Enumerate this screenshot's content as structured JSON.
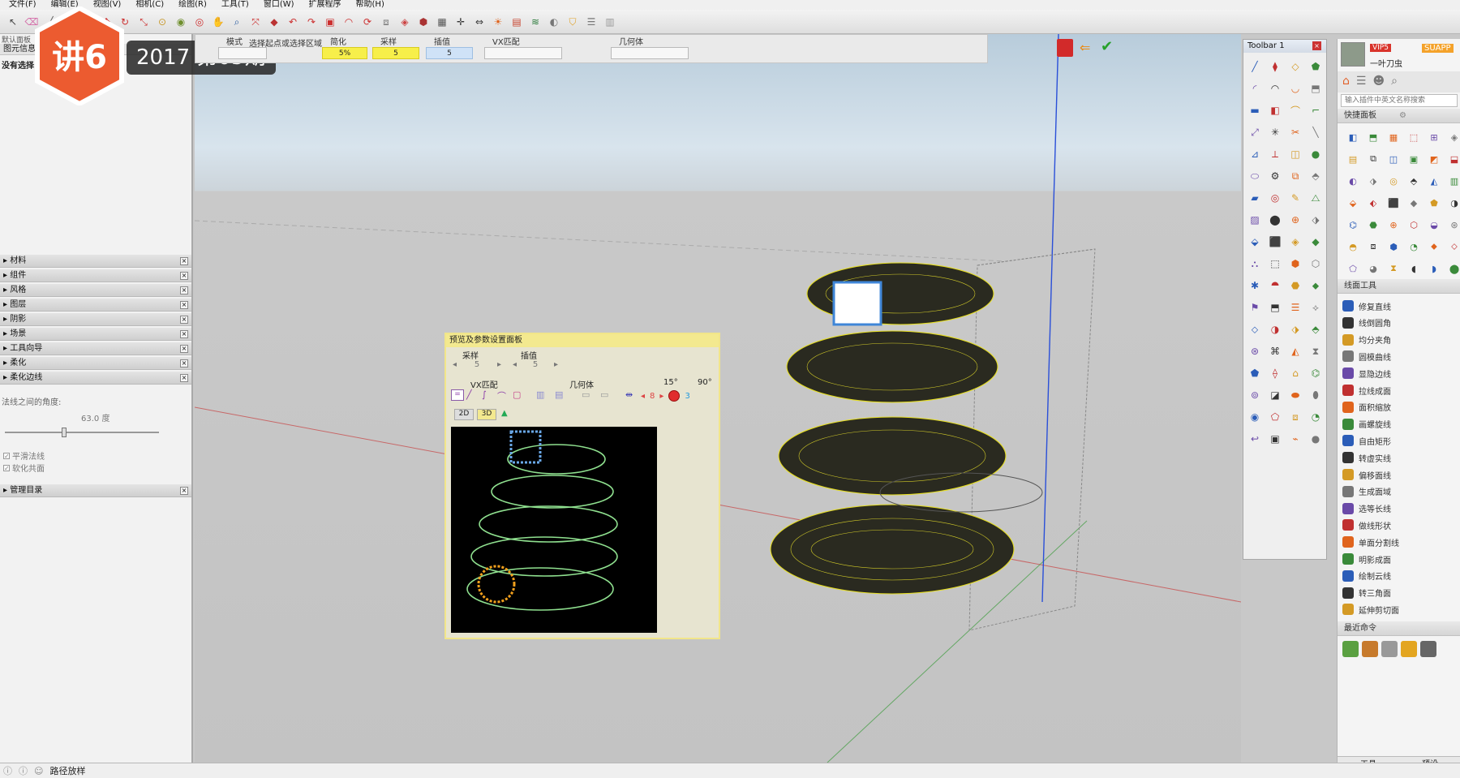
{
  "menu": [
    "文件(F)",
    "编辑(E)",
    "视图(V)",
    "相机(C)",
    "绘图(R)",
    "工具(T)",
    "窗口(W)",
    "扩展程序",
    "帮助(H)"
  ],
  "toolbar": {
    "icons": [
      {
        "name": "select-arrow-icon",
        "glyph": "↖",
        "color": "#444"
      },
      {
        "name": "eraser-icon",
        "glyph": "⌫",
        "color": "#d46ca8"
      },
      {
        "name": "line-tool-icon",
        "glyph": "╱",
        "color": "#5c5c5c"
      },
      {
        "name": "rectangle-tool-icon",
        "glyph": "▭",
        "color": "#c23c3c"
      },
      {
        "name": "push-pull-icon",
        "glyph": "⬍",
        "color": "#cc2f2f"
      },
      {
        "name": "move-tool-icon",
        "glyph": "✥",
        "color": "#cc2f2f"
      },
      {
        "name": "rotate-tool-icon",
        "glyph": "↻",
        "color": "#cc2f2f"
      },
      {
        "name": "scale-tool-icon",
        "glyph": "⤡",
        "color": "#cc2f2f"
      },
      {
        "name": "tape-measure-icon",
        "glyph": "⊙",
        "color": "#c89a2d"
      },
      {
        "name": "paint-bucket-icon",
        "glyph": "◉",
        "color": "#6f8f2e"
      },
      {
        "name": "orbit-icon",
        "glyph": "◎",
        "color": "#cc2f2f"
      },
      {
        "name": "pan-icon",
        "glyph": "✋",
        "color": "#c5962c"
      },
      {
        "name": "zoom-icon",
        "glyph": "⌕",
        "color": "#2a5b9f"
      },
      {
        "name": "zoom-extents-icon",
        "glyph": "⤧",
        "color": "#cc2f2f"
      },
      {
        "name": "component-icon",
        "glyph": "◆",
        "color": "#b33"
      },
      {
        "name": "undo-icon",
        "glyph": "↶",
        "color": "#cc2f2f"
      },
      {
        "name": "redo-icon",
        "glyph": "↷",
        "color": "#cc2f2f"
      },
      {
        "name": "su-plugin-icon",
        "glyph": "▣",
        "color": "#cc2f2f"
      },
      {
        "name": "arc-tool-icon",
        "glyph": "◠",
        "color": "#cc2f2f"
      },
      {
        "name": "follow-me-icon",
        "glyph": "⟳",
        "color": "#cc2f2f"
      },
      {
        "name": "offset-icon",
        "glyph": "⧈",
        "color": "#777"
      },
      {
        "name": "section-plane-icon",
        "glyph": "◈",
        "color": "#c44"
      },
      {
        "name": "solid-tools-icon",
        "glyph": "⬢",
        "color": "#a33"
      },
      {
        "name": "sandbox-icon",
        "glyph": "▦",
        "color": "#555"
      },
      {
        "name": "axes-icon",
        "glyph": "✛",
        "color": "#333"
      },
      {
        "name": "walk-icon",
        "glyph": "⇔",
        "color": "#333"
      },
      {
        "name": "shadows-icon",
        "glyph": "☀",
        "color": "#e0641d"
      },
      {
        "name": "grid-icon",
        "glyph": "▤",
        "color": "#c8432e"
      },
      {
        "name": "fog-icon",
        "glyph": "≋",
        "color": "#2b7a3a"
      },
      {
        "name": "styles-icon",
        "glyph": "◐",
        "color": "#777"
      },
      {
        "name": "shield-icon",
        "glyph": "⛉",
        "color": "#e0a32b"
      },
      {
        "name": "layers-icon",
        "glyph": "☰",
        "color": "#777"
      },
      {
        "name": "outliner-icon",
        "glyph": "▥",
        "color": "#999"
      }
    ]
  },
  "options_strip": {
    "hint": "选择起点或选择区域",
    "fields": [
      {
        "label": "模式",
        "value": ""
      },
      {
        "label": "简化",
        "value": "5%"
      },
      {
        "label": "采样",
        "value": "5"
      },
      {
        "label": "插值",
        "value": "5"
      },
      {
        "label": "VX匹配",
        "value": ""
      },
      {
        "label": "几何体",
        "value": ""
      }
    ]
  },
  "left_panel": {
    "header": "默认面板",
    "entity_info": "图元信息",
    "no_selection": "没有选择",
    "trays": [
      "材料",
      "组件",
      "风格",
      "图层",
      "阴影",
      "场景",
      "工具向导",
      "柔化",
      "柔化边线"
    ],
    "soften": {
      "angle_label": "法线之间的角度:",
      "angle_value": "63.0 度",
      "smooth_normals": "平滑法线",
      "soften_coplanar": "软化共面"
    },
    "manage_tray": "管理目录"
  },
  "badge": {
    "logo_text": "讲6",
    "issue": "2017 第05期"
  },
  "preview_dialog": {
    "title": "预览及参数设置面板",
    "sample_label": "采样",
    "sample_value": "5",
    "interp_label": "插值",
    "interp_value": "5",
    "vx_label": "VX匹配",
    "geom_label": "几何体",
    "angle_15": "15°",
    "angle_90": "90°",
    "counter_red": "8",
    "counter_blue": "3",
    "tab_2d": "2D",
    "tab_3d": "3D"
  },
  "toolbar1": {
    "title": "Toolbar 1",
    "icons": [
      "╱",
      "⧫",
      "◇",
      "⬟",
      "◜",
      "◠",
      "◡",
      "⬒",
      "▬",
      "◧",
      "⌒",
      "⌐",
      "⤢",
      "✳",
      "✂",
      "╲",
      "⊿",
      "⟂",
      "◫",
      "●",
      "⬭",
      "⚙",
      "⧉",
      "⬘",
      "▰",
      "◎",
      "✎",
      "⧍",
      "▨",
      "⬤",
      "⊕",
      "⬗",
      "⬙",
      "⬛",
      "◈",
      "◆",
      "⛬",
      "⬚",
      "⬢",
      "⬡",
      "✱",
      "⯊",
      "⬣",
      "⬥",
      "⚑",
      "⬒",
      "☰",
      "⟡",
      "⬦",
      "◑",
      "⬗",
      "⬘",
      "⊛",
      "⌘",
      "◭",
      "⧗",
      "⬟",
      "⟠",
      "⌂",
      "⌬",
      "⊚",
      "◪",
      "⬬",
      "⬮",
      "◉",
      "⬠",
      "⧈",
      "◔",
      "↩",
      "▣",
      "⌁",
      "●"
    ]
  },
  "plugin_panel": {
    "username": "一叶刀虫",
    "vip": "VIP5",
    "brand": "SUAPP",
    "search_placeholder": "输入插件中英文名称搜索",
    "quick_panel": "快捷面板",
    "line_tools": "线面工具",
    "items": [
      "修复直线",
      "线倒圆角",
      "均分夹角",
      "圆模曲线",
      "显隐边线",
      "拉线成面",
      "面积缩放",
      "画螺旋线",
      "自由矩形",
      "转虚实线",
      "偏移面线",
      "生成面域",
      "选等长线",
      "做线形状",
      "单面分割线",
      "明影成面",
      "绘制云线",
      "转三角面",
      "延伸剪切面"
    ],
    "recent": "最近命令",
    "bottom_left": "工具",
    "bottom_right": "预设"
  },
  "status_bar": {
    "text": "路径放样"
  }
}
